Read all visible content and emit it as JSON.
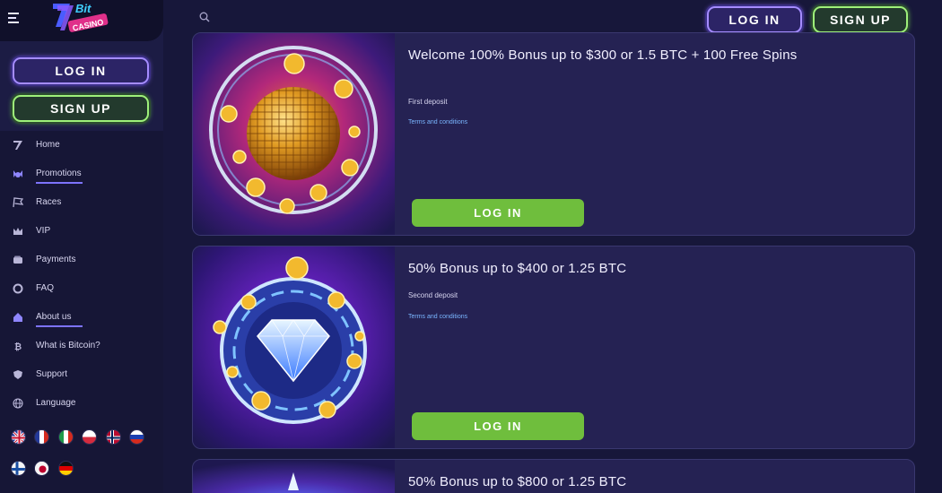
{
  "sidebar": {
    "login_label": "LOG IN",
    "signup_label": "SIGN UP",
    "nav": [
      {
        "label": "Home",
        "icon": "logo-7-icon"
      },
      {
        "label": "Promotions",
        "icon": "promotions-icon",
        "active": true
      },
      {
        "label": "Races",
        "icon": "race-flag-icon"
      },
      {
        "label": "VIP",
        "icon": "crown-icon"
      },
      {
        "label": "Payments",
        "icon": "wallet-icon"
      },
      {
        "label": "FAQ",
        "icon": "lifebuoy-icon"
      },
      {
        "label": "About us",
        "icon": "home-icon",
        "active": true
      },
      {
        "label": "What is Bitcoin?",
        "icon": "bitcoin-icon"
      },
      {
        "label": "Support",
        "icon": "shield-icon"
      },
      {
        "label": "Language",
        "icon": "globe-icon"
      }
    ],
    "flags": [
      "flag-uk",
      "flag-france",
      "flag-italy",
      "flag-poland",
      "flag-norway",
      "flag-russia",
      "flag-finland",
      "flag-japan",
      "flag-germany"
    ]
  },
  "topbar": {
    "login_label": "LOG IN",
    "signup_label": "SIGN UP"
  },
  "promotions": [
    {
      "title": "Welcome 100% Bonus up to $300 or 1.5 BTC + 100 Free Spins",
      "subtitle": "First deposit",
      "terms": "Terms and conditions",
      "button": "LOG IN"
    },
    {
      "title": "50% Bonus up to $400 or 1.25 BTC",
      "subtitle": "Second deposit",
      "terms": "Terms and conditions",
      "button": "LOG IN"
    },
    {
      "title": "50% Bonus up to $800 or 1.25 BTC"
    }
  ],
  "colors": {
    "background": "#17173a",
    "accent_purple": "#a58cff",
    "accent_green": "#9ef07a",
    "button_green": "#6fbe3d",
    "link_blue": "#7ab6ff"
  }
}
